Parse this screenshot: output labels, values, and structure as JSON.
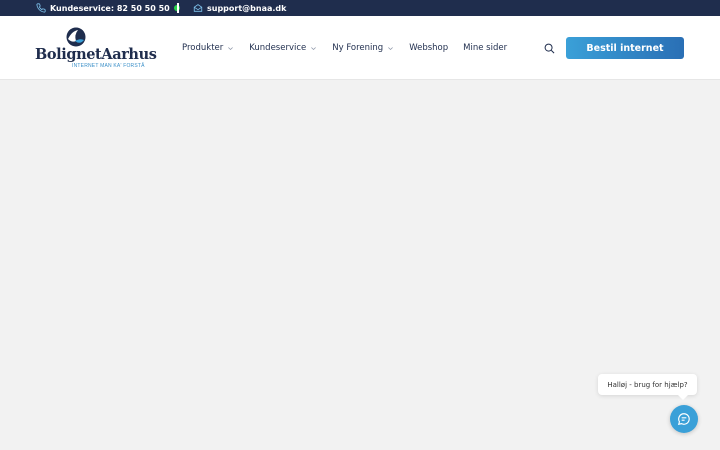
{
  "topbar": {
    "phone_label": "Kundeservice: 82 50 50 50",
    "email_label": "support@bnaa.dk",
    "icons": {
      "phone": "phone-icon",
      "email": "envelope-icon",
      "status": "online-status-dot"
    },
    "status_color": "#27d44a"
  },
  "header": {
    "logo": {
      "name": "BolignetAarhus",
      "tagline": "INTERNET MAN KA' FORSTÅ"
    },
    "nav": [
      {
        "label": "Produkter",
        "has_dropdown": true
      },
      {
        "label": "Kundeservice",
        "has_dropdown": true
      },
      {
        "label": "Ny Forening",
        "has_dropdown": true
      },
      {
        "label": "Webshop",
        "has_dropdown": false
      },
      {
        "label": "Mine sider",
        "has_dropdown": false
      }
    ],
    "search_icon": "search-icon",
    "cta_label": "Bestil internet"
  },
  "chat": {
    "bubble_text": "Halløj - brug for hjælp? ",
    "launcher_icon": "chat-icon"
  },
  "colors": {
    "topbar_bg": "#1f2d4d",
    "accent": "#3aa0d8",
    "brand_dark": "#1f2d4d",
    "page_bg": "#f2f2f2"
  }
}
